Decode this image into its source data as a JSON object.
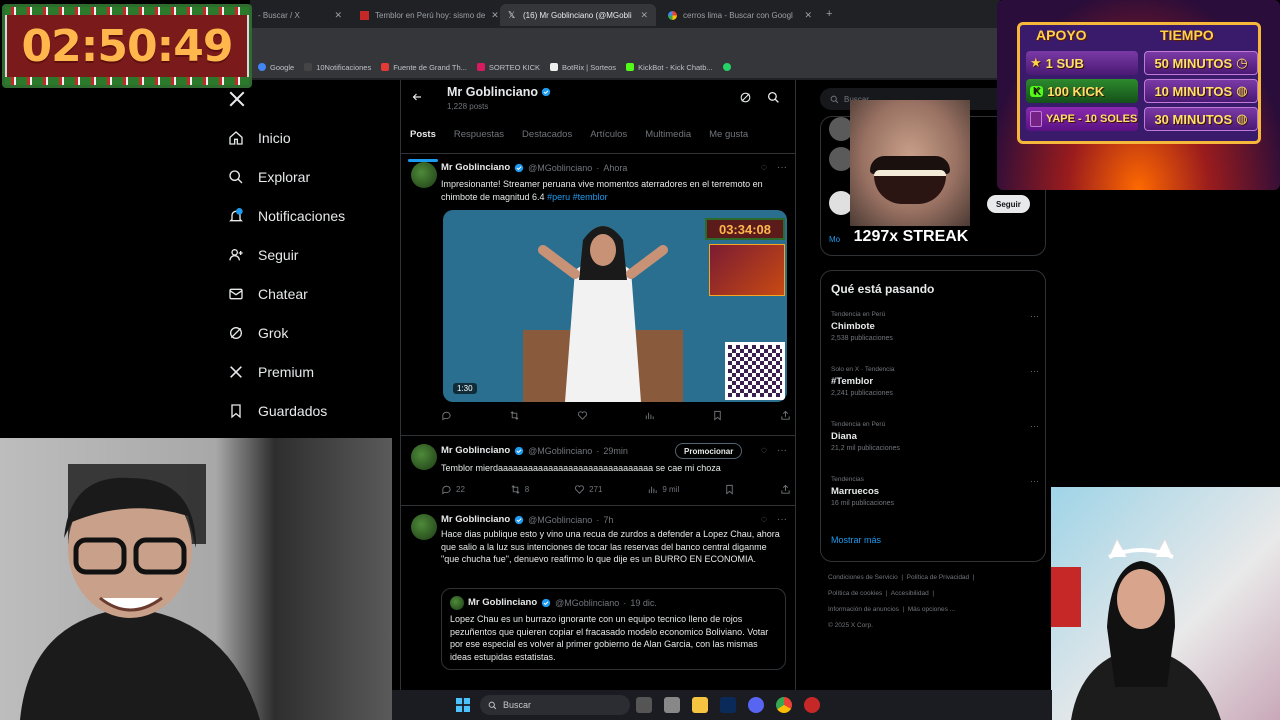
{
  "timer_overlay": {
    "time": "02:50:49"
  },
  "browser": {
    "tabs": [
      {
        "label": "- Buscar / X",
        "active": false
      },
      {
        "label": "Temblor en Perú hoy: sismo de",
        "active": false
      },
      {
        "label": "(16) Mr Goblinciano (@MGobli",
        "active": true
      },
      {
        "label": "cerros lima - Buscar con Googl",
        "active": false
      }
    ],
    "new_tab": "+",
    "bookmarks": [
      "Google",
      "10Notificaciones",
      "Fuente de Grand Th...",
      "SORTEO KICK",
      "BotRix | Sorteos",
      "KickBot - Kick Chatb..."
    ]
  },
  "x_app": {
    "nav": [
      {
        "label": "Inicio",
        "icon": "home-icon"
      },
      {
        "label": "Explorar",
        "icon": "search-icon"
      },
      {
        "label": "Notificaciones",
        "icon": "bell-icon"
      },
      {
        "label": "Seguir",
        "icon": "follow-icon"
      },
      {
        "label": "Chatear",
        "icon": "mail-icon"
      },
      {
        "label": "Grok",
        "icon": "grok-icon"
      },
      {
        "label": "Premium",
        "icon": "x-icon"
      },
      {
        "label": "Guardados",
        "icon": "bookmark-icon"
      }
    ],
    "profile": {
      "name": "Mr Goblinciano",
      "posts_count": "1,228 posts"
    },
    "tabs": [
      "Posts",
      "Respuestas",
      "Destacados",
      "Artículos",
      "Multimedia",
      "Me gusta"
    ],
    "posts": [
      {
        "name": "Mr Goblinciano",
        "handle": "@MGoblinciano",
        "time": "Ahora",
        "text": "Impresionante! Streamer peruana vive momentos aterradores en el terremoto en chimbote de magnitud 6.4",
        "hashtags": "#peru #temblor",
        "media_timer": "03:34:08",
        "media_duration": "1:30"
      },
      {
        "name": "Mr Goblinciano",
        "handle": "@MGoblinciano",
        "time": "29min",
        "promote": "Promocionar",
        "text": "Temblor mierdaaaaaaaaaaaaaaaaaaaaaaaaaaaaaaa se cae mi choza",
        "replies": "22",
        "reposts": "8",
        "likes": "271",
        "views": "9 mil"
      },
      {
        "name": "Mr Goblinciano",
        "handle": "@MGoblinciano",
        "time": "7h",
        "text": "Hace dias publique esto y vino una recua de zurdos a defender a Lopez Chau, ahora que salio a la luz sus intenciones de tocar las reservas del banco central diganme \"que chucha fue\", denuevo reafirmo lo que dije es un BURRO EN ECONOMIA.",
        "quote": {
          "name": "Mr Goblinciano",
          "handle": "@MGoblinciano",
          "time": "19 dic.",
          "text": "Lopez Chau es un burrazo ignorante con un equipo tecnico lleno de rojos pezuñentos que quieren copiar el fracasado modelo economico Boliviano. Votar por ese especial es volver al primer gobierno de Alan Garcia, con las mismas ideas estupidas estatistas."
        }
      }
    ],
    "search_placeholder": "Buscar",
    "follow_button": "Seguir",
    "show_more_top": "Mo",
    "trends_title": "Qué está pasando",
    "trends": [
      {
        "category": "Tendencia en Perú",
        "name": "Chimbote",
        "count": "2,538 publicaciones"
      },
      {
        "category": "Solo en X · Tendencia",
        "name": "#Temblor",
        "count": "2,241 publicaciones"
      },
      {
        "category": "Tendencia en Perú",
        "name": "Diana",
        "count": "21,2 mil publicaciones"
      },
      {
        "category": "Tendencias",
        "name": "Marruecos",
        "count": "16 mil publicaciones"
      }
    ],
    "show_more": "Mostrar más",
    "footer": [
      "Condiciones de Servicio",
      "Política de Privacidad",
      "Política de cookies",
      "Accesibilidad",
      "Información de anuncios",
      "Más opciones ...",
      "© 2025 X Corp."
    ]
  },
  "streak_overlay": {
    "text": "1297x STREAK"
  },
  "donation_panel": {
    "col1_header": "APOYO",
    "col2_header": "TIEMPO",
    "rows": [
      {
        "left": "1 SUB",
        "right": "50 MINUTOS"
      },
      {
        "left": "100 KICK",
        "right": "10 MINUTOS"
      },
      {
        "left": "YAPE - 10 SOLES",
        "right": "30 MINUTOS"
      }
    ]
  },
  "taskbar": {
    "search_label": "Buscar"
  },
  "colors": {
    "x_blue": "#1d9bf0",
    "x_text": "#e7e9ea",
    "x_muted": "#71767b",
    "x_border": "#2f3336",
    "timer_orange": "#ffb74d",
    "panel_gold": "#ffd24a"
  }
}
